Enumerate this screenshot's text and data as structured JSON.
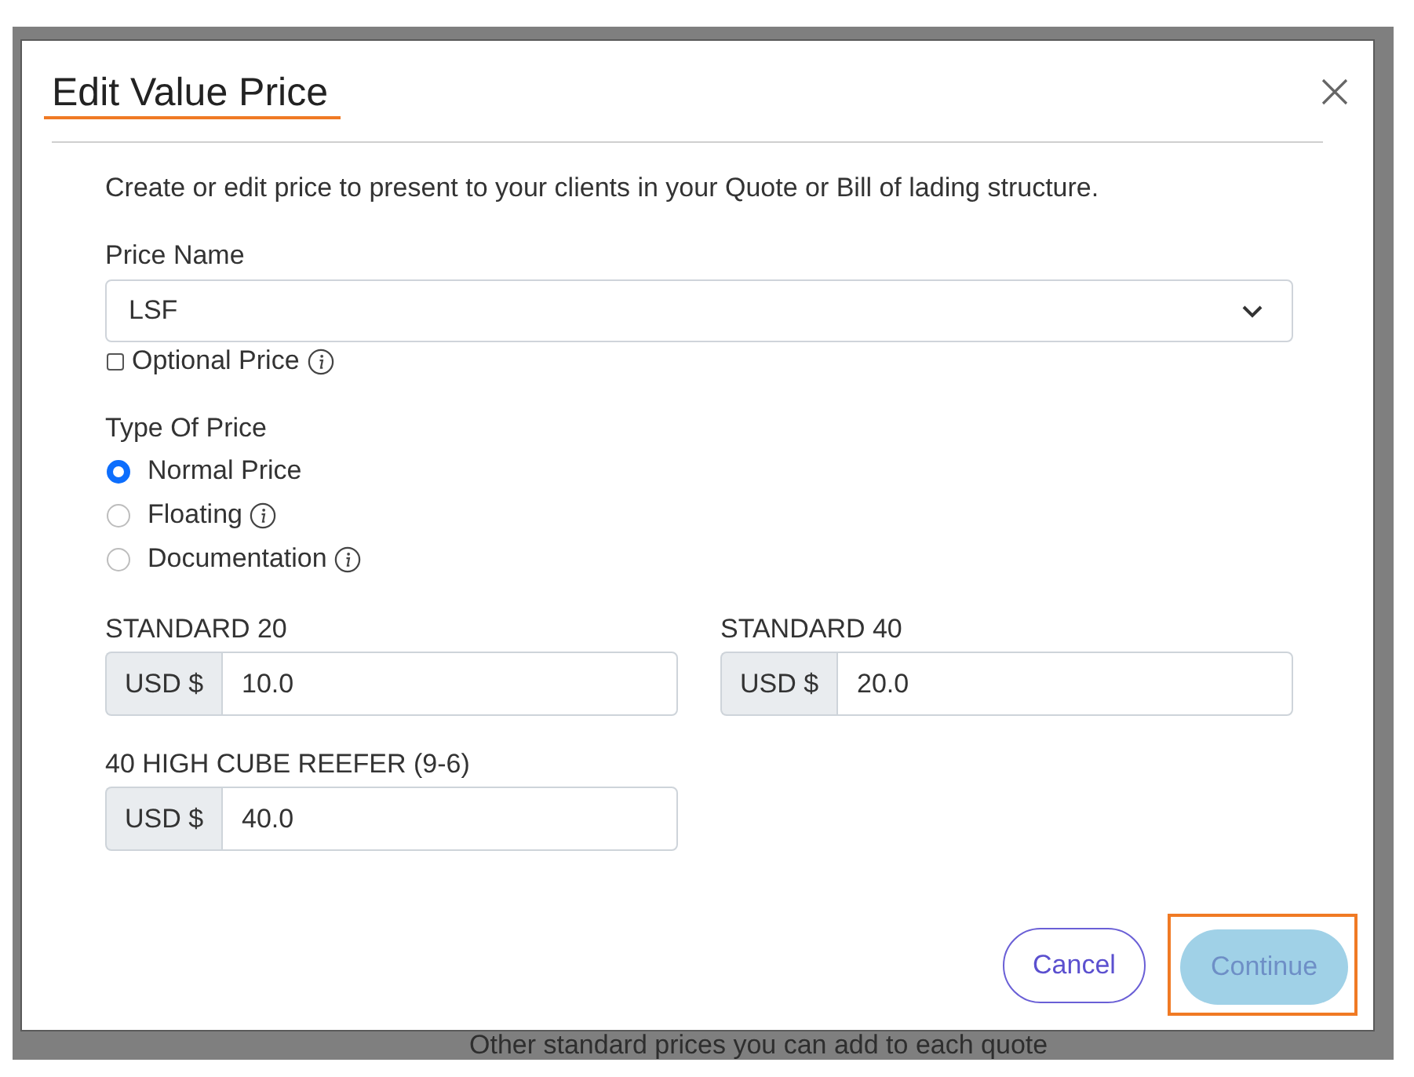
{
  "dialog": {
    "title": "Edit Value Price",
    "description": "Create or edit price to present to your clients in your Quote or Bill of lading structure."
  },
  "price_name": {
    "label": "Price Name",
    "value": "LSF"
  },
  "optional_price": {
    "label": "Optional Price",
    "checked": false,
    "info": true
  },
  "price_type": {
    "label": "Type Of Price",
    "options": [
      {
        "label": "Normal Price",
        "selected": true,
        "info": false
      },
      {
        "label": "Floating",
        "selected": false,
        "info": true
      },
      {
        "label": "Documentation",
        "selected": false,
        "info": true
      }
    ]
  },
  "container_prices": [
    {
      "label": "STANDARD 20",
      "currency": "USD $",
      "value": "10.0"
    },
    {
      "label": "STANDARD 40",
      "currency": "USD $",
      "value": "20.0"
    },
    {
      "label": "40 HIGH CUBE REEFER (9-6)",
      "currency": "USD $",
      "value": "40.0"
    }
  ],
  "buttons": [
    {
      "label": "Cancel",
      "kind": "secondary",
      "disabled": false,
      "highlighted": false
    },
    {
      "label": "Continue",
      "kind": "primary",
      "disabled": true,
      "highlighted": true
    }
  ],
  "background_text": "Other standard prices you can add to each quote"
}
